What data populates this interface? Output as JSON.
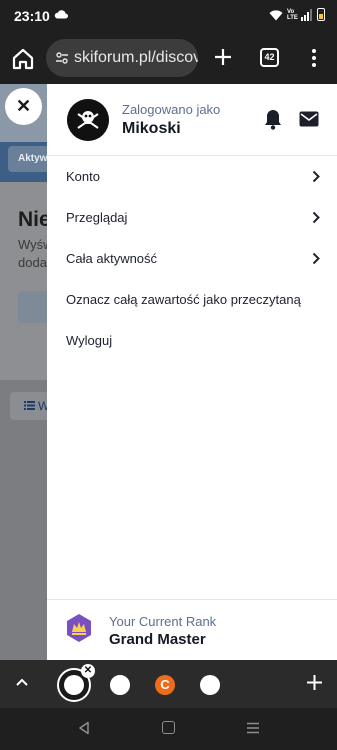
{
  "status_bar": {
    "time": "23:10"
  },
  "browser": {
    "url": "skiforum.pl/discover",
    "tab_count": "42"
  },
  "page": {
    "nav_label": "Aktywność",
    "title": "Nie",
    "desc_line1": "Wyśw",
    "desc_line2": "doda",
    "list_button_label": "W"
  },
  "drawer": {
    "signed_in_label": "Zalogowano jako",
    "username": "Mikoski",
    "menu": [
      {
        "label": "Konto",
        "has_submenu": true
      },
      {
        "label": "Przeglądaj",
        "has_submenu": true
      },
      {
        "label": "Cała aktywność",
        "has_submenu": true
      },
      {
        "label": "Oznacz całą zawartość jako przeczytaną",
        "has_submenu": false
      },
      {
        "label": "Wyloguj",
        "has_submenu": false
      }
    ],
    "rank_label": "Your Current Rank",
    "rank_value": "Grand Master"
  },
  "tabstrip": {
    "other_tab_letter": "C"
  },
  "colors": {
    "accent_link": "#5f6e91",
    "drawer_bg": "#ffffff",
    "rank_badge": "#7a4fc2"
  }
}
